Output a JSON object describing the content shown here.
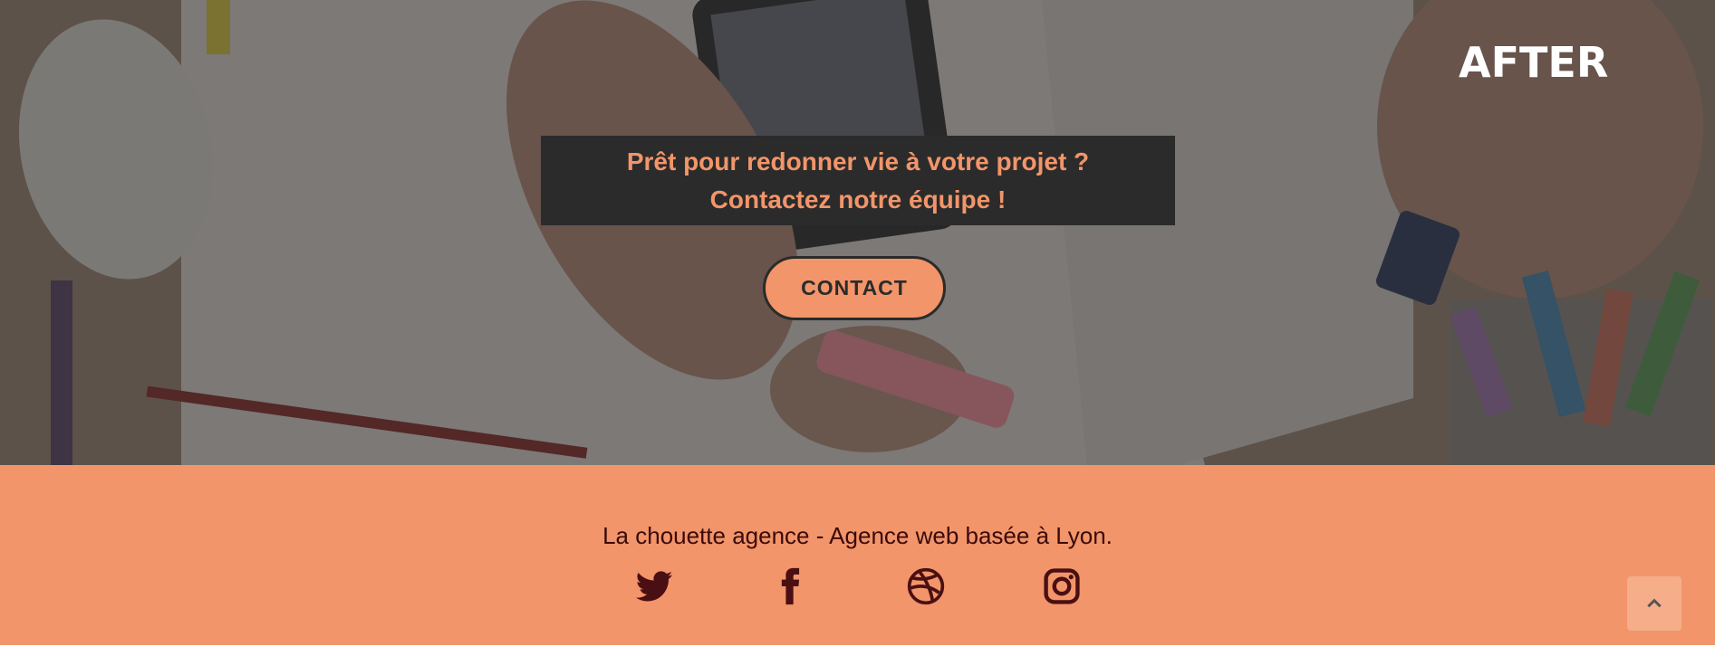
{
  "hero": {
    "badge": "AFTER",
    "cta_line_1": "Prêt pour redonner vie à votre projet ?",
    "cta_line_2": "Contactez notre équipe !",
    "contact_button": "CONTACT"
  },
  "footer": {
    "tagline": "La chouette agence - Agence web basée à Lyon.",
    "social": [
      {
        "icon": "twitter-icon"
      },
      {
        "icon": "facebook-icon"
      },
      {
        "icon": "dribbble-icon"
      },
      {
        "icon": "instagram-icon"
      }
    ],
    "scroll_top_icon": "chevron-up-icon"
  },
  "colors": {
    "accent": "#f2956a",
    "dark": "#2b2b2b",
    "footer_text": "#3a0a0a"
  }
}
